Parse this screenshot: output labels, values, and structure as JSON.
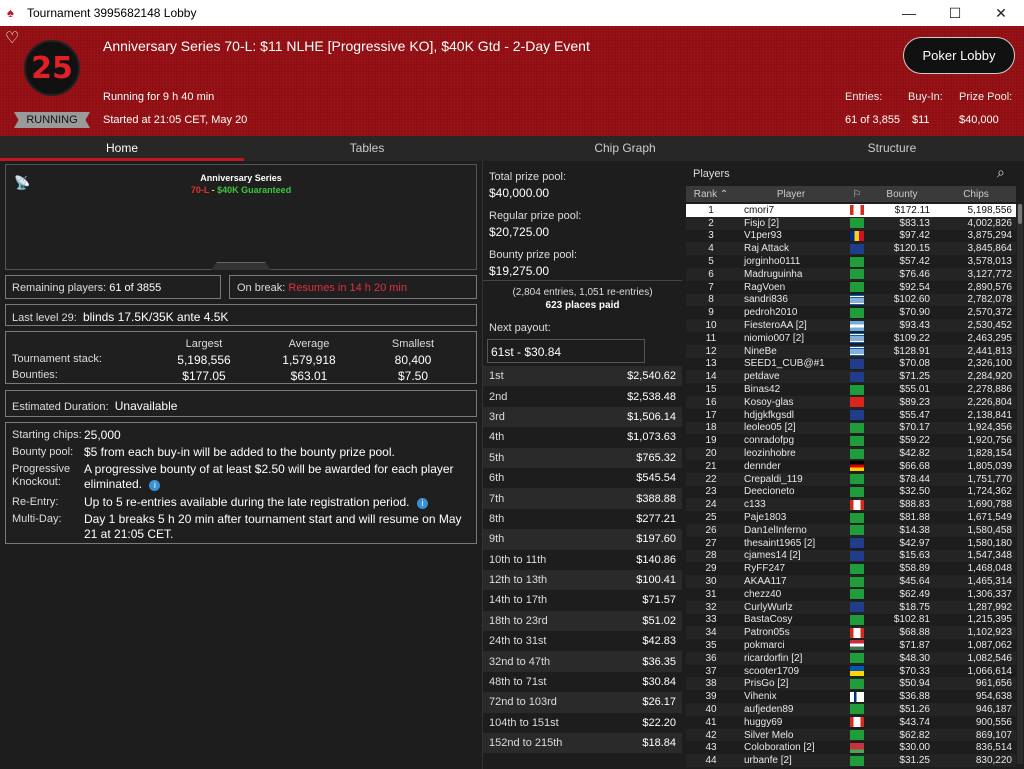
{
  "window": {
    "title": "Tournament 3995682148 Lobby",
    "minimize": "—",
    "maximize": "☐",
    "close": "✕"
  },
  "header": {
    "title": "Anniversary Series 70-L: $11 NLHE [Progressive KO], $40K Gtd - 2-Day Event",
    "running_for": "Running for 9 h 40 min",
    "started": "Started at 21:05 CET, May 20",
    "status": "RUNNING",
    "badge": "25",
    "lobby_button": "Poker Lobby",
    "entries_label": "Entries:",
    "entries_value": "61 of 3,855",
    "buyin_label": "Buy-In:",
    "buyin_value": "$11",
    "prize_label": "Prize Pool:",
    "prize_value": "$40,000"
  },
  "tabs": [
    "Home",
    "Tables",
    "Chip Graph",
    "Structure"
  ],
  "home": {
    "series_title": "Anniversary Series",
    "series_code": "70-L",
    "series_sep": " - ",
    "series_gtd": "$40K Guaranteed",
    "remaining_label": "Remaining players:",
    "remaining_value": "61 of 3855",
    "break_label": "On break:",
    "break_value": "Resumes in 14 h 20 min",
    "last_level_label": "Last level 29:",
    "last_level_value": "blinds 17.5K/35K ante 4.5K",
    "stats": {
      "col_largest": "Largest",
      "col_average": "Average",
      "col_smallest": "Smallest",
      "stack_label": "Tournament stack:",
      "stack_largest": "5,198,556",
      "stack_average": "1,579,918",
      "stack_smallest": "80,400",
      "bounty_label": "Bounties:",
      "bounty_largest": "$177.05",
      "bounty_average": "$63.01",
      "bounty_smallest": "$7.50"
    },
    "duration_label": "Estimated Duration:",
    "duration_value": "Unavailable",
    "starting_chips_label": "Starting chips:",
    "starting_chips_value": "25,000",
    "bounty_pool_label": "Bounty pool:",
    "bounty_pool_value": "$5 from each buy-in will be added to the bounty prize pool.",
    "pko_label": "Progressive Knockout:",
    "pko_value": "A progressive bounty of at least $2.50 will be awarded for each player eliminated.",
    "reentry_label": "Re-Entry:",
    "reentry_value": "Up to 5 re-entries available during the late registration period.",
    "multiday_label": "Multi-Day:",
    "multiday_value": "Day 1 breaks 5 h 20 min after tournament start and will resume on May 21 at 21:05 CET."
  },
  "prizes": {
    "total_label": "Total prize pool:",
    "total_value": "$40,000.00",
    "regular_label": "Regular prize pool:",
    "regular_value": "$20,725.00",
    "bounty_label": "Bounty prize pool:",
    "bounty_value": "$19,275.00",
    "entries_note": "(2,804 entries, 1,051 re-entries)",
    "paid_note": "623 places paid",
    "next_label": "Next payout:",
    "next_value": "61st - $30.84",
    "rows": [
      [
        "1st",
        "$2,540.62"
      ],
      [
        "2nd",
        "$2,538.48"
      ],
      [
        "3rd",
        "$1,506.14"
      ],
      [
        "4th",
        "$1,073.63"
      ],
      [
        "5th",
        "$765.32"
      ],
      [
        "6th",
        "$545.54"
      ],
      [
        "7th",
        "$388.88"
      ],
      [
        "8th",
        "$277.21"
      ],
      [
        "9th",
        "$197.60"
      ],
      [
        "10th to 11th",
        "$140.86"
      ],
      [
        "12th to 13th",
        "$100.41"
      ],
      [
        "14th to 17th",
        "$71.57"
      ],
      [
        "18th to 23rd",
        "$51.02"
      ],
      [
        "24th to 31st",
        "$42.83"
      ],
      [
        "32nd to 47th",
        "$36.35"
      ],
      [
        "48th to 71st",
        "$30.84"
      ],
      [
        "72nd to 103rd",
        "$26.17"
      ],
      [
        "104th to 151st",
        "$22.20"
      ],
      [
        "152nd to 215th",
        "$18.84"
      ]
    ]
  },
  "players": {
    "title": "Players",
    "col_rank": "Rank",
    "col_player": "Player",
    "col_bounty": "Bounty",
    "col_chips": "Chips",
    "rows": [
      [
        "1",
        "cmori7",
        "ca",
        "$172.11",
        "5,198,556"
      ],
      [
        "2",
        "Fisjo [2]",
        "br",
        "$83.13",
        "4,002,826"
      ],
      [
        "3",
        "V1per93",
        "ro",
        "$97.42",
        "3,875,294"
      ],
      [
        "4",
        "Raj Attack",
        "gb",
        "$120.15",
        "3,845,864"
      ],
      [
        "5",
        "jorginho0111",
        "br",
        "$57.42",
        "3,578,013"
      ],
      [
        "6",
        "Madruguinha",
        "br",
        "$76.46",
        "3,127,772"
      ],
      [
        "7",
        "RagVoen",
        "br",
        "$92.54",
        "2,890,576"
      ],
      [
        "8",
        "sandri836",
        "gr",
        "$102.60",
        "2,782,078"
      ],
      [
        "9",
        "pedroh2010",
        "br",
        "$70.90",
        "2,570,372"
      ],
      [
        "10",
        "FiesteroAA [2]",
        "ar",
        "$93.43",
        "2,530,452"
      ],
      [
        "11",
        "niomio007 [2]",
        "gr",
        "$109.22",
        "2,463,295"
      ],
      [
        "12",
        "NineBe",
        "gr",
        "$128.91",
        "2,441,813"
      ],
      [
        "13",
        "SEED1_CUB@#1",
        "gb",
        "$70.08",
        "2,326,100"
      ],
      [
        "14",
        "petdave",
        "gb",
        "$71.25",
        "2,284,920"
      ],
      [
        "15",
        "Binas42",
        "br",
        "$55.01",
        "2,278,886"
      ],
      [
        "16",
        "Kosoy-glas",
        "vn",
        "$89.23",
        "2,226,804"
      ],
      [
        "17",
        "hdjgkfkgsdl",
        "gb",
        "$55.47",
        "2,138,841"
      ],
      [
        "18",
        "leoleo05 [2]",
        "br",
        "$70.17",
        "1,924,356"
      ],
      [
        "19",
        "conradofpg",
        "br",
        "$59.22",
        "1,920,756"
      ],
      [
        "20",
        "leozinhobre",
        "br",
        "$42.82",
        "1,828,154"
      ],
      [
        "21",
        "dennder",
        "de",
        "$66.68",
        "1,805,039"
      ],
      [
        "22",
        "Crepaldi_119",
        "br",
        "$78.44",
        "1,751,770"
      ],
      [
        "23",
        "Deecioneto",
        "br",
        "$32.50",
        "1,724,362"
      ],
      [
        "24",
        "c133",
        "ca",
        "$88.83",
        "1,690,788"
      ],
      [
        "25",
        "Paje1803",
        "br",
        "$81.88",
        "1,671,549"
      ],
      [
        "26",
        "Dan1elInferno",
        "br",
        "$14.38",
        "1,580,458"
      ],
      [
        "27",
        "thesaint1965 [2]",
        "gb",
        "$42.97",
        "1,580,180"
      ],
      [
        "28",
        "cjames14 [2]",
        "gb",
        "$15.63",
        "1,547,348"
      ],
      [
        "29",
        "RyFF247",
        "br",
        "$58.89",
        "1,468,048"
      ],
      [
        "30",
        "AKAA117",
        "br",
        "$45.64",
        "1,465,314"
      ],
      [
        "31",
        "chezz40",
        "br",
        "$62.49",
        "1,306,337"
      ],
      [
        "32",
        "CurlyWurlz",
        "gb",
        "$18.75",
        "1,287,992"
      ],
      [
        "33",
        "BastaCosy",
        "br",
        "$102.81",
        "1,215,395"
      ],
      [
        "34",
        "Patron05s",
        "ca",
        "$68.88",
        "1,102,923"
      ],
      [
        "35",
        "pokmarci",
        "hu",
        "$71.87",
        "1,087,062"
      ],
      [
        "36",
        "ricardorfin [2]",
        "br",
        "$48.30",
        "1,082,546"
      ],
      [
        "37",
        "scooter1709",
        "ua",
        "$70.33",
        "1,066,614"
      ],
      [
        "38",
        "PrisGo [2]",
        "br",
        "$50.94",
        "961,656"
      ],
      [
        "39",
        "Vihenix",
        "fi",
        "$36.88",
        "954,638"
      ],
      [
        "40",
        "aufjeden89",
        "br",
        "$51.26",
        "946,187"
      ],
      [
        "41",
        "huggy69",
        "ca",
        "$43.74",
        "900,556"
      ],
      [
        "42",
        "Silver Melo",
        "br",
        "$62.82",
        "869,107"
      ],
      [
        "43",
        "Coloboration [2]",
        "by",
        "$30.00",
        "836,514"
      ],
      [
        "44",
        "urbanfe [2]",
        "br",
        "$31.25",
        "830,220"
      ]
    ]
  },
  "colors": {
    "accent": "#c0161c",
    "gtd": "#3ec43e",
    "break": "#e0303a",
    "header_bg": "#8c1013"
  }
}
